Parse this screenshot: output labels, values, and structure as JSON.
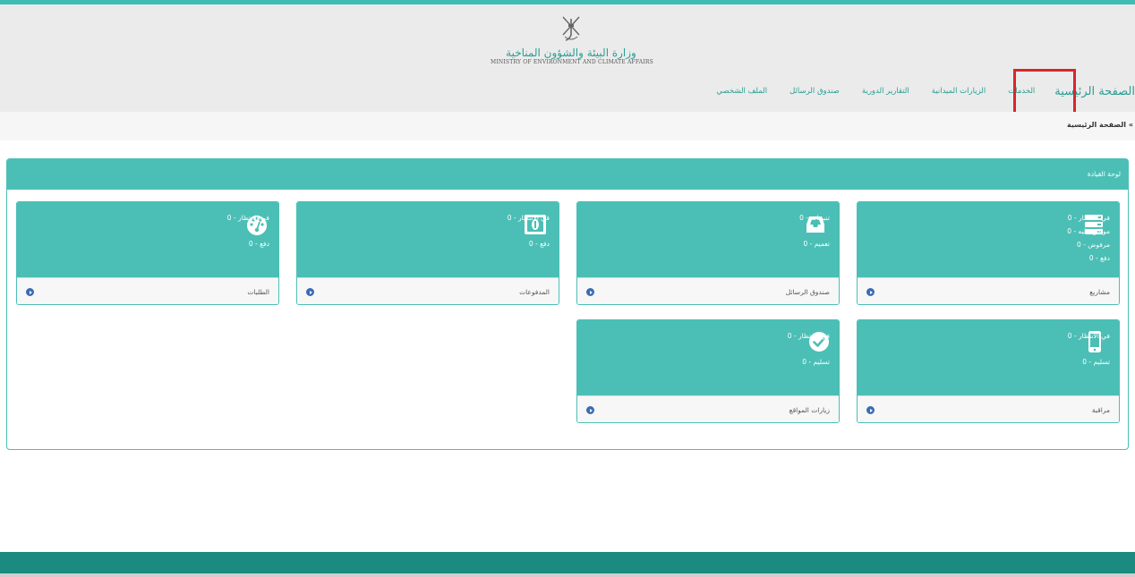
{
  "colors": {
    "accent": "#4bbfb6",
    "nav_text": "#2a9e93",
    "highlight": "#d9262b",
    "footer": "#1b8a7f",
    "arrow": "#3a6bb5"
  },
  "header": {
    "logo_icon": "khanjar-emblem-icon",
    "logo_ar": "وزارة البيئة والشؤون المناخية",
    "logo_en": "MINISTRY OF ENVIRONMENT AND CLIMATE AFFAIRS"
  },
  "nav": {
    "brand": "الصفحة الرئيسية",
    "items": [
      "الخدمات",
      "الزيارات الميدانية",
      "التقارير الدورية",
      "صندوق الرسائل",
      "الملف الشخصي"
    ]
  },
  "breadcrumb": "الصفحة الرئيسية",
  "panel": {
    "title": "لوحة القيادة",
    "cards": [
      {
        "icon": "server-icon",
        "stats": [
          "في الانتظار - 0",
          "موافق عليه - 0",
          "مرفوض - 0",
          "دفع - 0"
        ],
        "label": "مشاريع"
      },
      {
        "icon": "inbox-icon",
        "stats": [
          "تنبيهات - 0",
          "تعميم - 0"
        ],
        "label": "صندوق الرسائل"
      },
      {
        "icon": "money-icon",
        "stats": [
          "في الانتظار - 0",
          "دفع - 0"
        ],
        "label": "المدفوعات"
      },
      {
        "icon": "dashboard-gauge-icon",
        "stats": [
          "في الانتظار - 0",
          "دفع - 0"
        ],
        "label": "الطلبات"
      },
      {
        "icon": "mobile-phone-icon",
        "stats": [
          "في الانتظار - 0",
          "تسليم - 0"
        ],
        "label": "مراقبة"
      },
      {
        "icon": "check-circle-icon",
        "stats": [
          "في الانتظار - 0",
          "تسليم - 0"
        ],
        "label": "زيارات المواقع"
      }
    ]
  }
}
